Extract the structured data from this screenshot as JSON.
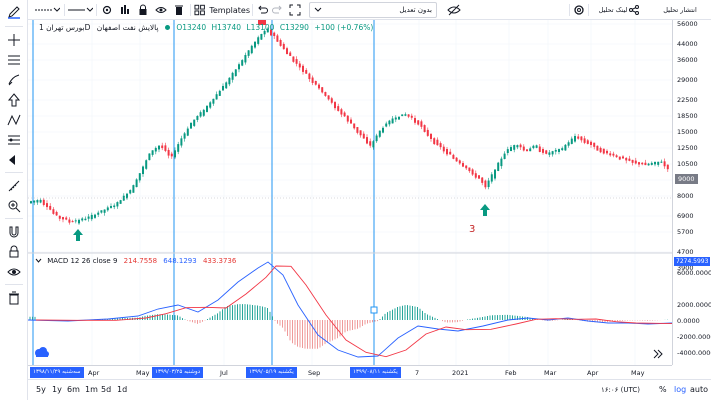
{
  "top_bar": {
    "line_width_label": "1px",
    "templates_label": "Templates",
    "timezone_select": "بدون تعدیل",
    "link_label": "لینک تحلیل",
    "publish_label": "انتشار تحلیل"
  },
  "legend": {
    "symbol": "پالایش نفت اصفهان",
    "interval": "1D",
    "exchange": "بورس تهران",
    "open": "O13240",
    "high": "H13740",
    "low": "L13100",
    "close": "C13290",
    "change": "+100 (+0.76%)"
  },
  "macd_legend": {
    "title": "MACD 12 26 close 9",
    "v1": "214.7558",
    "v2": "648.1293",
    "v3": "433.3736"
  },
  "price_axis": {
    "labels": [
      "56000",
      "44000",
      "36000",
      "29000",
      "22500",
      "18500",
      "15000",
      "12500",
      "10500",
      "9000",
      "8000",
      "6900",
      "5700",
      "4700",
      "3900"
    ],
    "current_price": "9000"
  },
  "macd_axis": {
    "labels": [
      "6000.0000",
      "4000.0000",
      "2000.0000",
      "0.0000",
      "-2000.0000",
      "-4000.0000"
    ],
    "current_value": "7274.5993"
  },
  "annotations": {
    "number_label": "3"
  },
  "time_axis": {
    "labels": [
      "Apr",
      "May",
      "Jul",
      "Sep",
      "7",
      "2021",
      "Feb",
      "Mar",
      "Apr",
      "May"
    ],
    "badges": [
      "سه‌شنبه ۱۳۹۸/۱۱/۲۹",
      "دوشنبه ۱۳۹۹/۰۳/۲۵",
      "یکشنبه ۱۳۹۹/۰۵/۱۹",
      "یکشنبه ۱۳۹۹/۰۸/۱۱"
    ]
  },
  "bottom_bar": {
    "ranges": [
      "5y",
      "1y",
      "6m",
      "1m",
      "5d",
      "1d"
    ],
    "clock": "۱۶:۰۶ (UTC)",
    "percent": "%",
    "log": "log",
    "auto": "auto"
  },
  "colors": {
    "up": "#089981",
    "down": "#f23645",
    "accent": "#2962ff",
    "macd_line": "#2962ff",
    "signal_line": "#f23645",
    "vertical_line": "#2196f3"
  }
}
